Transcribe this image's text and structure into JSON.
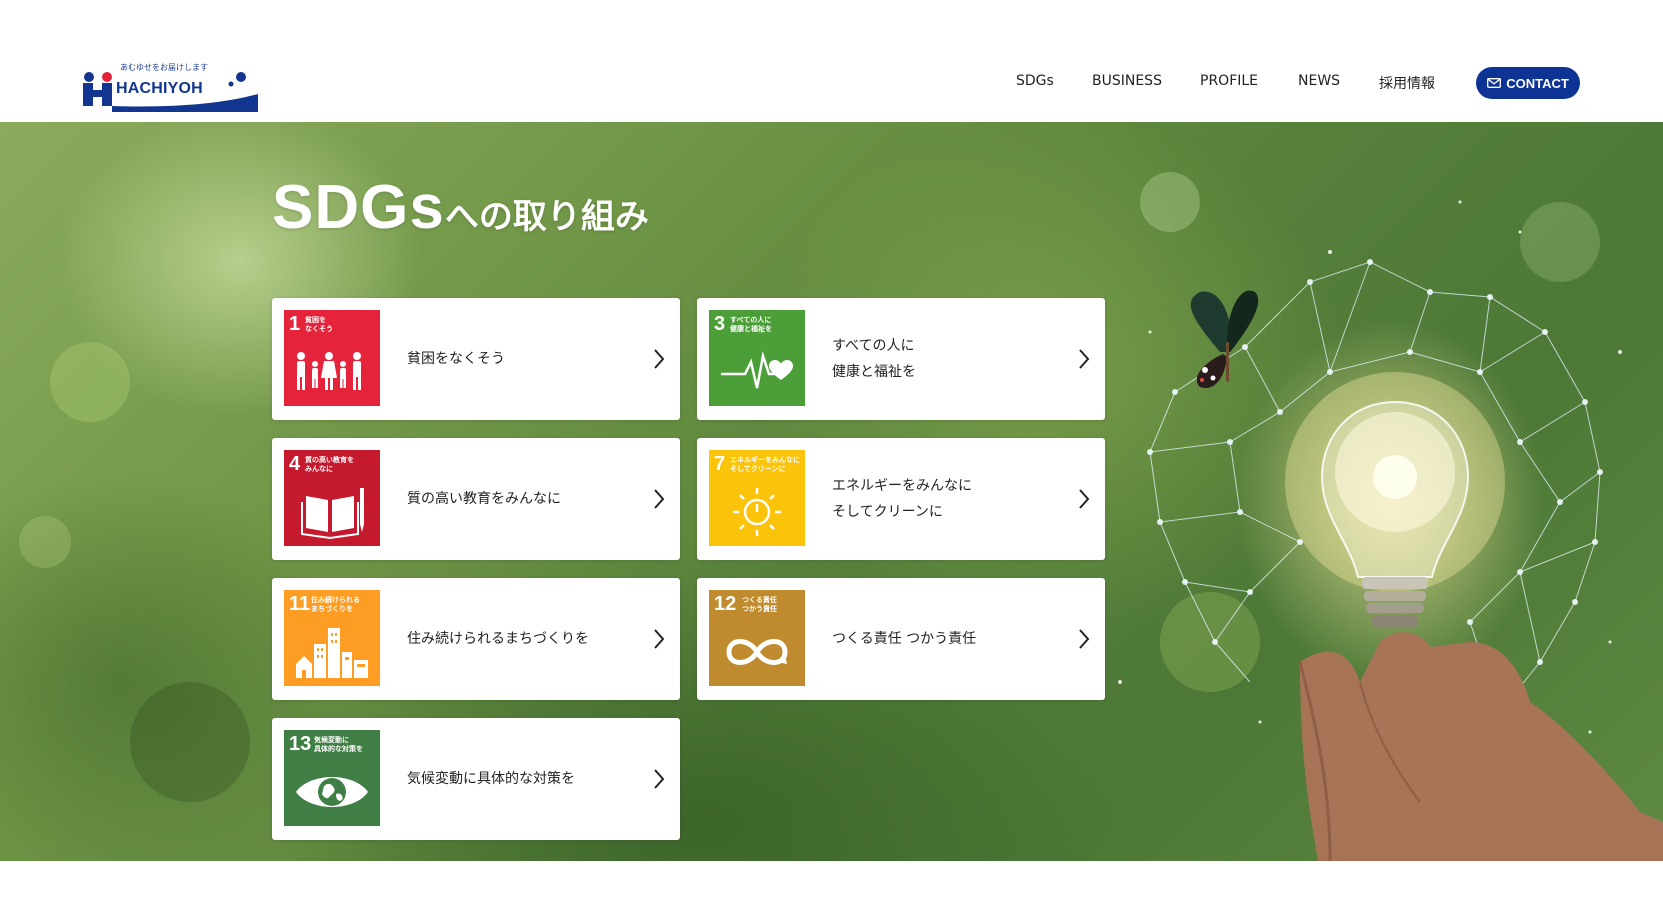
{
  "header": {
    "logo": {
      "tagline": "あむゆせをお届けします",
      "text": "HACHIYOH"
    },
    "nav": [
      {
        "label": "SDGs"
      },
      {
        "label": "BUSINESS"
      },
      {
        "label": "PROFILE"
      },
      {
        "label": "NEWS"
      },
      {
        "label": "採用情報"
      }
    ],
    "contact_label": "CONTACT"
  },
  "hero": {
    "title_main": "SDGs",
    "title_rest": "への取り組み"
  },
  "cards": [
    {
      "number": "1",
      "subtitle": "貧困を\nなくそう",
      "color": "#e5243b",
      "icon": "family-icon",
      "lines": [
        "貧困をなくそう"
      ]
    },
    {
      "number": "3",
      "subtitle": "すべての人に\n健康と福祉を",
      "color": "#4c9f38",
      "icon": "heartbeat-icon",
      "lines": [
        "すべての人に",
        "健康と福祉を"
      ]
    },
    {
      "number": "4",
      "subtitle": "質の高い教育を\nみんなに",
      "color": "#c5192d",
      "icon": "book-icon",
      "lines": [
        "質の高い教育をみんなに"
      ]
    },
    {
      "number": "7",
      "subtitle": "エネルギーをみんなに\nそしてクリーンに",
      "color": "#fcc30b",
      "icon": "power-sun-icon",
      "lines": [
        "エネルギーをみんなに",
        "そしてクリーンに"
      ]
    },
    {
      "number": "11",
      "subtitle": "住み続けられる\nまちづくりを",
      "color": "#fd9d24",
      "icon": "city-icon",
      "lines": [
        "住み続けられるまちづくりを"
      ]
    },
    {
      "number": "12",
      "subtitle": "つくる責任\nつかう責任",
      "color": "#bf8b2e",
      "icon": "infinity-icon",
      "lines": [
        "つくる責任 つかう責任"
      ]
    },
    {
      "number": "13",
      "subtitle": "気候変動に\n具体的な対策を",
      "color": "#3f7e44",
      "icon": "earth-eye-icon",
      "lines": [
        "気候変動に具体的な対策を"
      ]
    }
  ]
}
